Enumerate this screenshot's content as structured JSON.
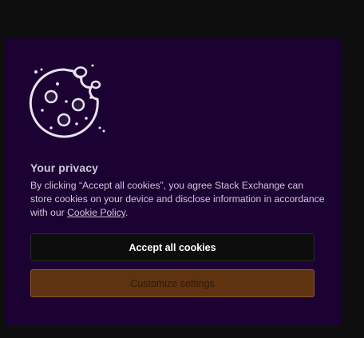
{
  "privacy": {
    "title": "Your privacy",
    "text_before_link": "By clicking “Accept all cookies”, you agree Stack Exchange can store cookies on your device and disclose information in accordance with our ",
    "link_text": "Cookie Policy",
    "text_after_link": "."
  },
  "buttons": {
    "accept_label": "Accept all cookies",
    "customize_label": "Customize settings"
  },
  "icons": {
    "illustration": "cookie-icon"
  },
  "colors": {
    "dialog_bg": "#1c0133",
    "accept_bg": "#0d0d0d",
    "customize_bg": "#5f3210"
  }
}
